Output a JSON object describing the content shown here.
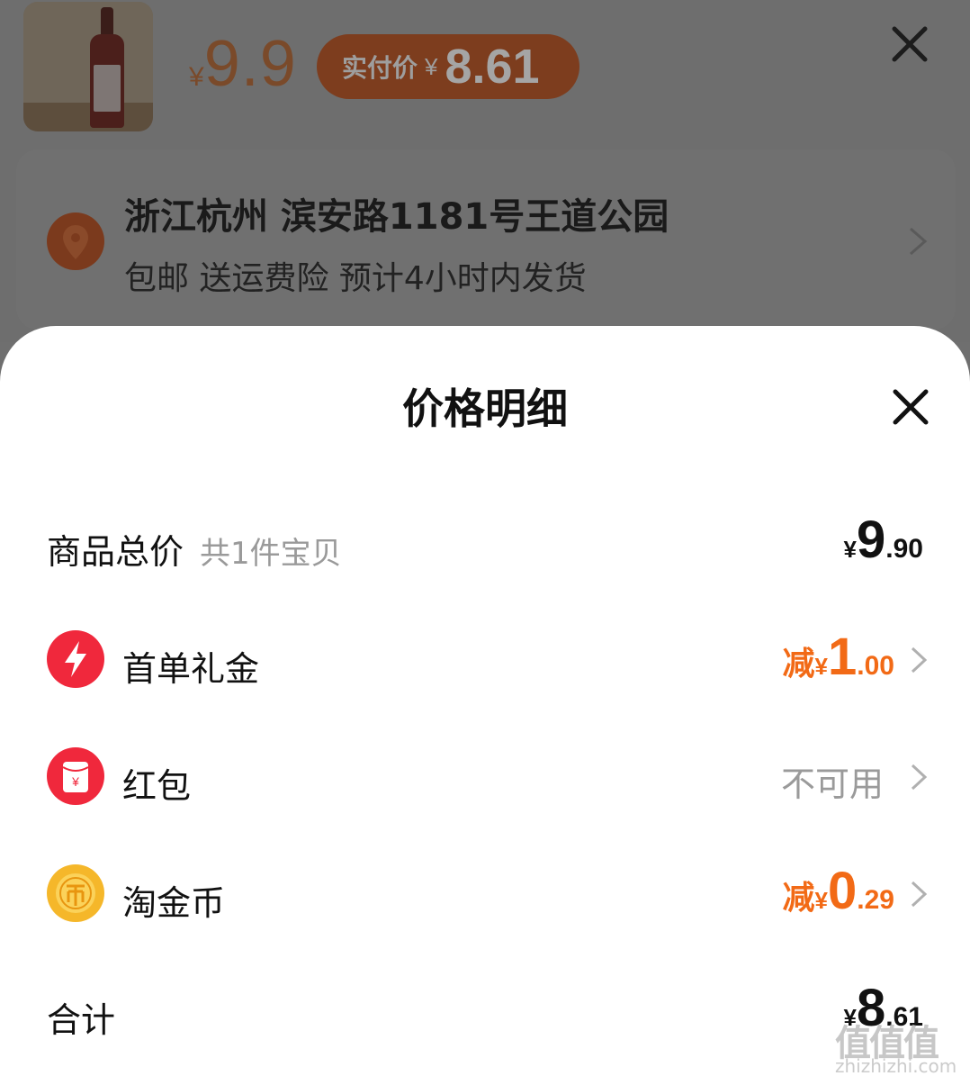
{
  "top": {
    "price_yen": "¥",
    "price": "9.9",
    "paid_label": "实付价",
    "paid_yen": "¥",
    "paid_price": "8.61"
  },
  "address": {
    "title": "浙江杭州 滨安路1181号王道公园",
    "subtitle": "包邮 送运费险 预计4小时内发货"
  },
  "sheet": {
    "title": "价格明细",
    "rows": [
      {
        "label": "商品总价",
        "hint": "共1件宝贝",
        "yen": "¥",
        "int": "9",
        "dec": ".90"
      },
      {
        "label": "首单礼金",
        "prefix": "减",
        "yen": "¥",
        "int": "1",
        "dec": ".00"
      },
      {
        "label": "红包",
        "status": "不可用"
      },
      {
        "label": "淘金币",
        "prefix": "减",
        "yen": "¥",
        "int": "0",
        "dec": ".29"
      },
      {
        "label": "合计",
        "yen": "¥",
        "int": "8",
        "dec": ".61"
      }
    ]
  },
  "watermark": {
    "logo": "值值值",
    "url": "zhizhizhi.com"
  },
  "colors": {
    "accent": "#f26a16",
    "red": "#f0283c",
    "gold": "#f5b72a"
  }
}
